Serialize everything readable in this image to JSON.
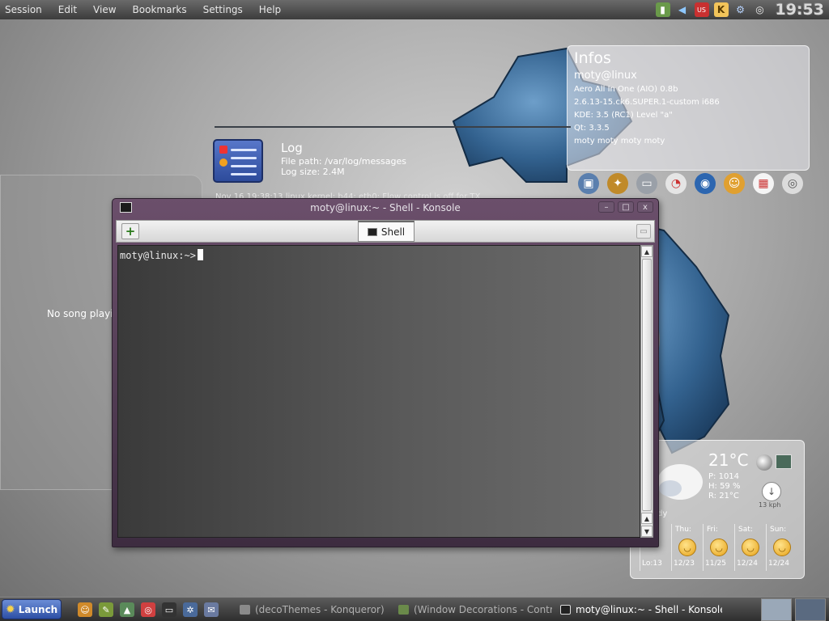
{
  "menubar": {
    "items": [
      "Session",
      "Edit",
      "View",
      "Bookmarks",
      "Settings",
      "Help"
    ]
  },
  "tray": {
    "icons": [
      "phone-icon",
      "send-icon",
      "us-flag-icon",
      "k-badge-icon",
      "network-icon",
      "disc-icon"
    ],
    "flag_text": "US",
    "k_text": "K",
    "clock": "19:53"
  },
  "infos": {
    "title": "Infos",
    "user": "moty@linux",
    "lines": [
      "Aero All In One (AIO) 0.8b",
      "2.6.13-15.ck6.SUPER.1-custom i686",
      "KDE: 3.5 (RC1) Level \"a\"",
      "Qt: 3.3.5",
      "moty moty moty moty"
    ],
    "icons": [
      "computer-icon",
      "apps-icon",
      "drive-icon",
      "gauge-icon",
      "network-globe-icon",
      "people-icon",
      "calendar-icon",
      "cd-icon"
    ]
  },
  "log": {
    "title": "Log",
    "path": "File path: /var/log/messages",
    "size": "Log size: 2.4M",
    "message": "Nov 16 19:38:13 linux kernel: b44: eth0: Flow control is off for TX"
  },
  "player": {
    "status": "No song playi"
  },
  "konsole": {
    "title": "moty@linux:~ - Shell - Konsole",
    "tab_label": "Shell",
    "prompt": "moty@linux:~>",
    "buttons": [
      "–",
      "□",
      "x"
    ]
  },
  "weather": {
    "temp": "21°C",
    "pressure": "P: 1014",
    "humidity": "H: 59 %",
    "realfeel": "R: 21°C",
    "wind": "13 kph",
    "condition": "dy",
    "days": [
      {
        "name": "",
        "date": "Lo:13"
      },
      {
        "name": "Thu:",
        "date": "12/23"
      },
      {
        "name": "Fri:",
        "date": "11/25"
      },
      {
        "name": "Sat:",
        "date": "12/24"
      },
      {
        "name": "Sun:",
        "date": "12/24"
      }
    ]
  },
  "taskbar": {
    "launch_label": "Launch",
    "tasks": [
      "(decoThemes - Konqueror)",
      "(Window Decorations - Contr",
      "moty@linux:~ - Shell - Konsole"
    ]
  },
  "colors": {
    "accent": "#2d4fa4",
    "konsole_frame": "#4e3a52",
    "gear": "#3e6f9e"
  }
}
